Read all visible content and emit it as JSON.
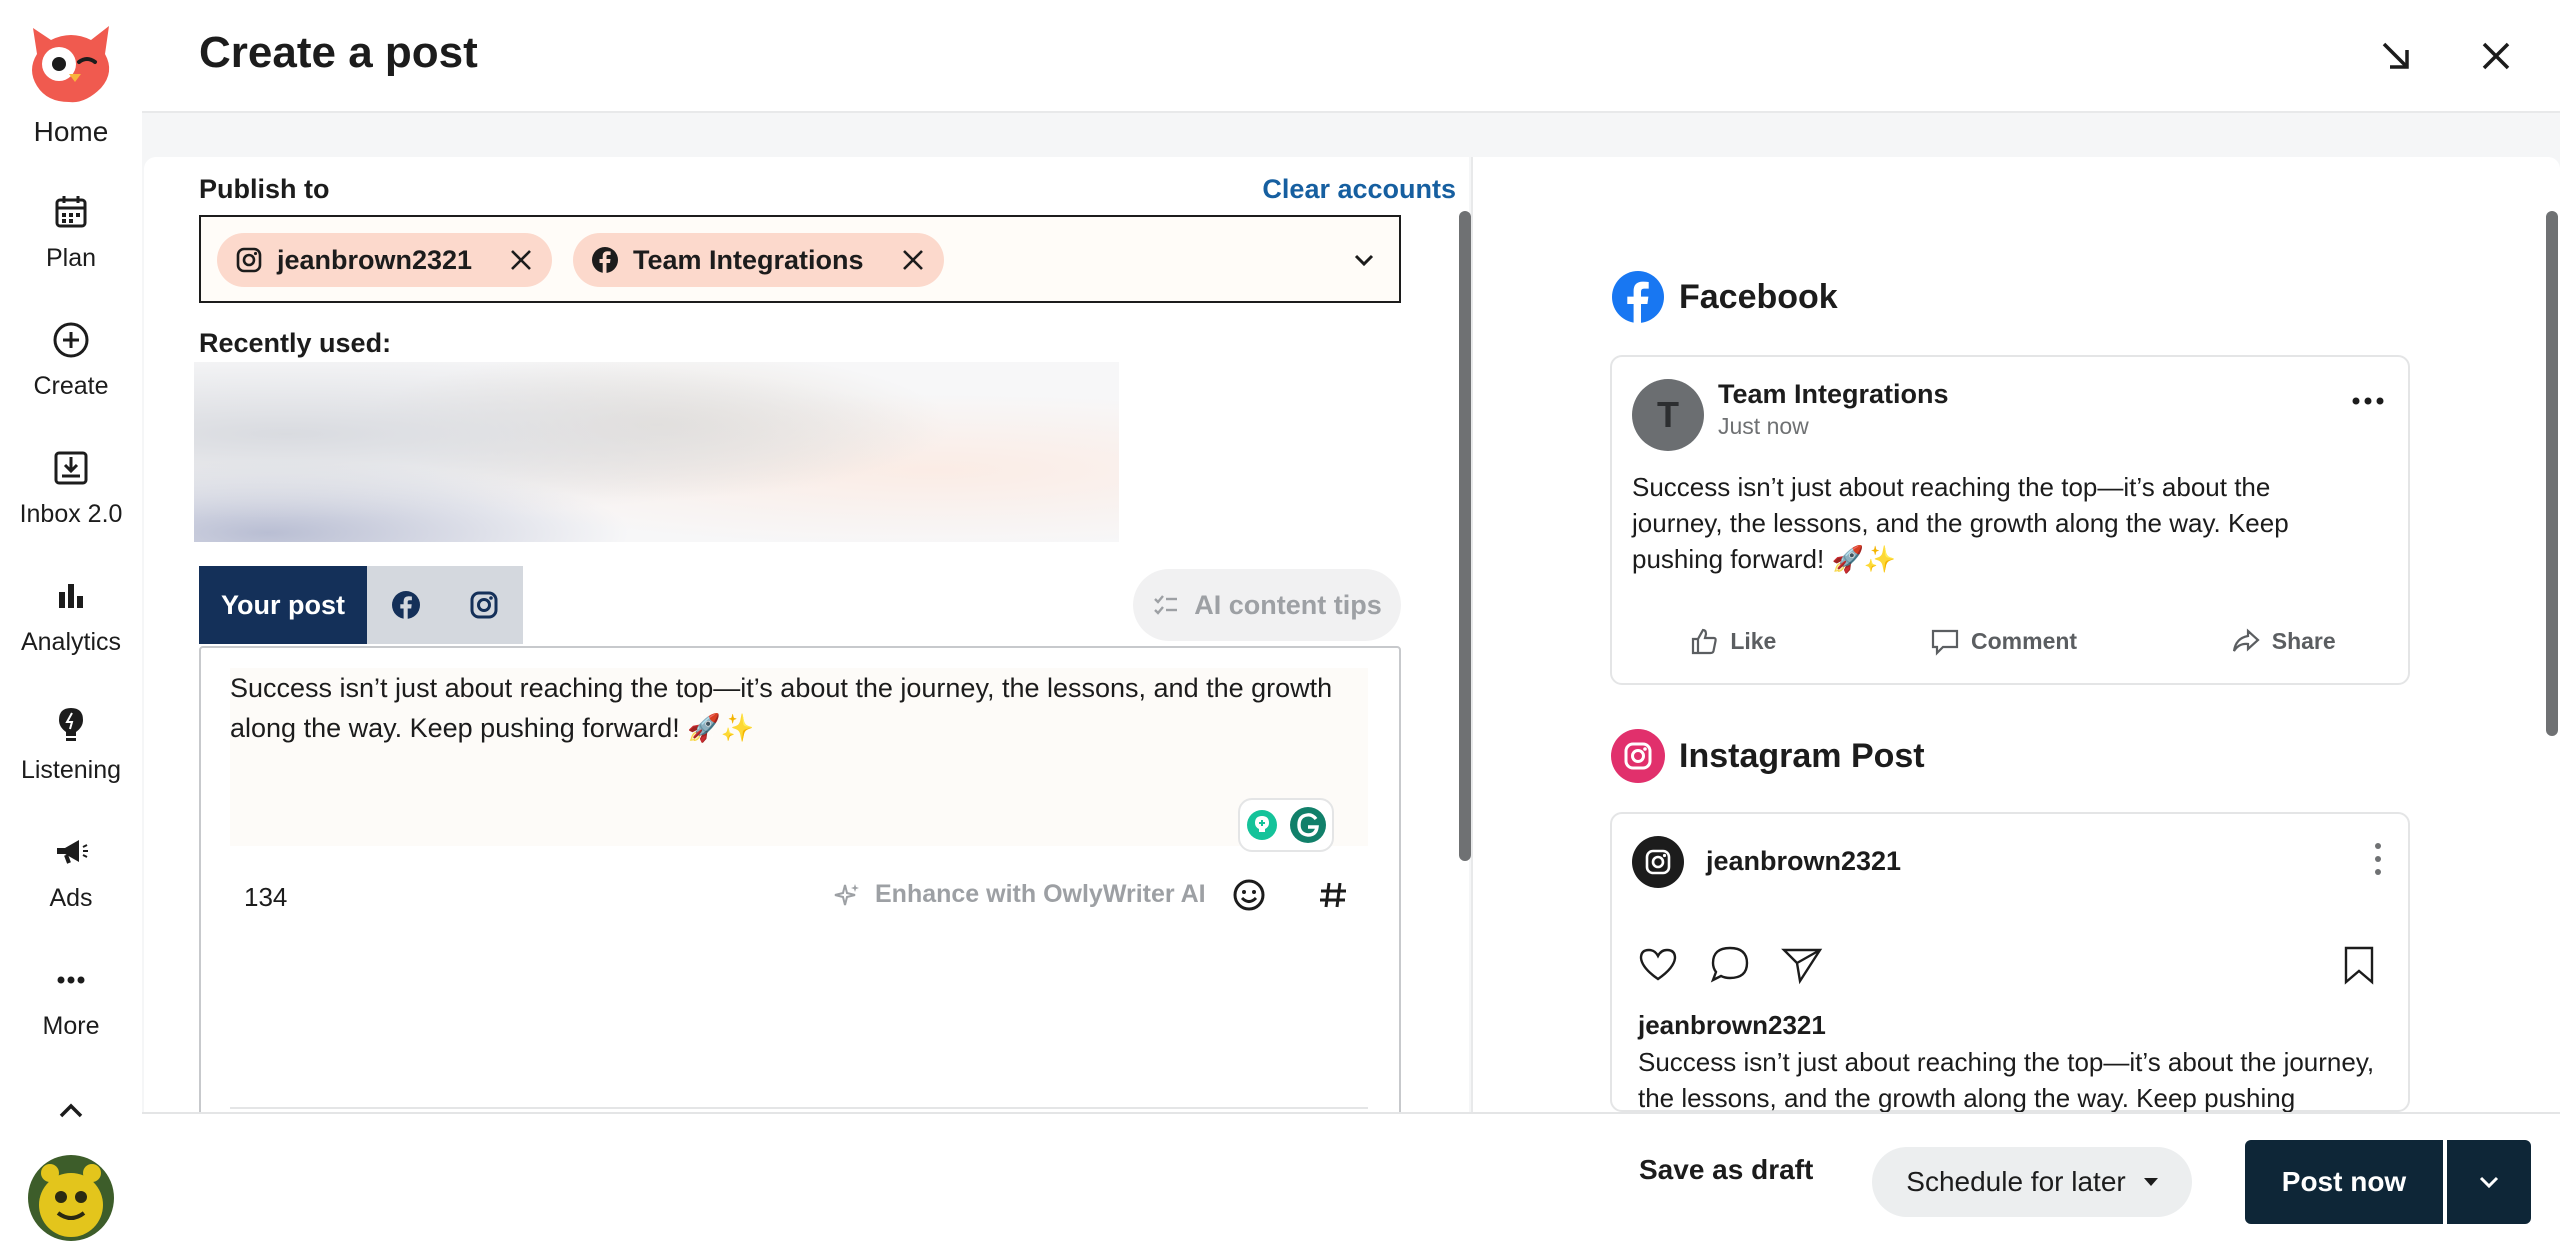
{
  "nav": {
    "home": "Home",
    "plan": "Plan",
    "create": "Create",
    "inbox": "Inbox 2.0",
    "analytics": "Analytics",
    "listening": "Listening",
    "ads": "Ads",
    "more": "More"
  },
  "header": {
    "title": "Create a post"
  },
  "publish": {
    "label": "Publish to",
    "clear": "Clear accounts",
    "accounts": [
      {
        "name": "jeanbrown2321",
        "network": "instagram-icon"
      },
      {
        "name": "Team Integrations",
        "network": "facebook-icon"
      }
    ],
    "recent_label": "Recently used:"
  },
  "tabs": {
    "your_post": "Your post"
  },
  "ai_tips": "AI content tips",
  "composer": {
    "text": "Success isn’t just about reaching the top—it’s about the journey, the lessons, and the growth along the way. Keep pushing forward! 🚀✨",
    "char_count": "134",
    "enhance": "Enhance with OwlyWriter AI"
  },
  "preview": {
    "facebook": {
      "heading": "Facebook",
      "avatar_letter": "T",
      "name": "Team Integrations",
      "time": "Just now",
      "text": "Success isn’t just about reaching the top—it’s about the journey, the lessons, and the growth along the way. Keep pushing forward! 🚀✨",
      "like": "Like",
      "comment": "Comment",
      "share": "Share"
    },
    "instagram": {
      "heading": "Instagram Post",
      "user": "jeanbrown2321",
      "caption_user": "jeanbrown2321",
      "text": "Success isn’t just about reaching the top—it’s about the journey, the lessons, and the growth along the way. Keep pushing forward! 🚀✨"
    }
  },
  "footer": {
    "save_draft": "Save as draft",
    "schedule": "Schedule for later",
    "post_now": "Post now"
  },
  "colors": {
    "accent_navy": "#143059",
    "chip": "#fcd9cc",
    "link": "#165fa0",
    "post_btn": "#0e2637",
    "facebook": "#1877f2",
    "instagram": "#e1306c"
  }
}
